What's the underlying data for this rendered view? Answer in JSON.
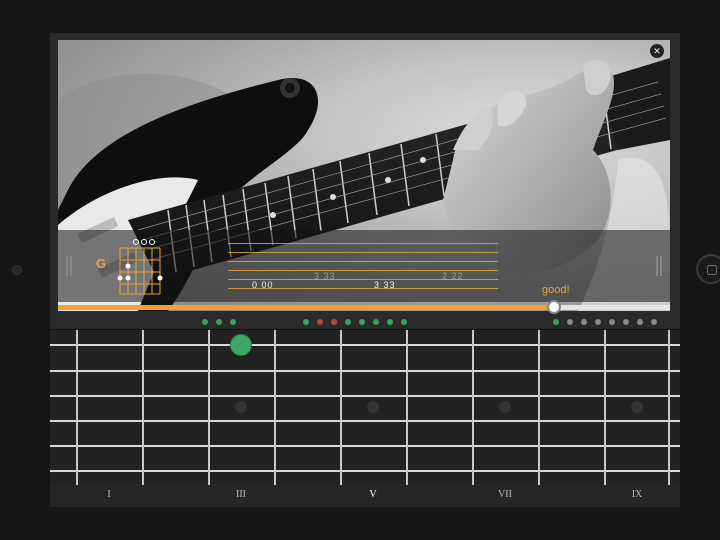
{
  "chord": {
    "name": "G",
    "open_string_markers": [
      "o",
      "o",
      "o"
    ]
  },
  "tab": {
    "line1": "0  00",
    "line2": "3  33",
    "line3": "3  33",
    "line4": "2  22"
  },
  "feedback": {
    "label": "good!",
    "accent_color": "#e7a33c"
  },
  "progress": {
    "played_fraction": 0.81
  },
  "status_dots": [
    {
      "state": "correct"
    },
    {
      "state": "correct"
    },
    {
      "state": "correct"
    },
    {
      "state": "correct"
    },
    {
      "state": "wrong"
    },
    {
      "state": "wrong"
    },
    {
      "state": "correct"
    },
    {
      "state": "correct"
    },
    {
      "state": "correct"
    },
    {
      "state": "correct"
    },
    {
      "state": "correct"
    },
    {
      "state": "correct"
    },
    {
      "state": "pending"
    },
    {
      "state": "pending"
    },
    {
      "state": "pending"
    },
    {
      "state": "pending"
    },
    {
      "state": "pending"
    },
    {
      "state": "pending"
    },
    {
      "state": "pending"
    }
  ],
  "status_colors": {
    "correct": "#2fa560",
    "wrong": "#b84545",
    "pending": "#8a8a8a"
  },
  "fretboard": {
    "fret_labels": [
      "I",
      "III",
      "V",
      "VII",
      "IX"
    ],
    "active_fret_label": "V",
    "target_note_color": "#3fa764"
  },
  "icons": {
    "mute": "speaker-mute-icon",
    "side_handle": "drag-handle-icon",
    "home": "home-button-icon"
  }
}
